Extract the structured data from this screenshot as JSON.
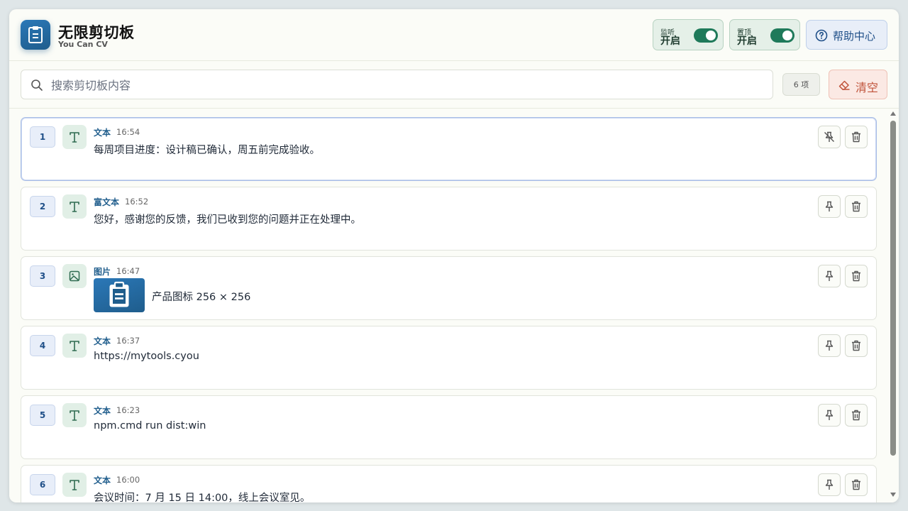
{
  "app": {
    "title": "无限剪切板",
    "subtitle": "You Can CV",
    "brand_color": "#1f5d8c"
  },
  "header": {
    "monitor": {
      "small_label": "监听",
      "state": "开启",
      "on": true
    },
    "pin_top": {
      "small_label": "置顶",
      "state": "开启",
      "on": true
    },
    "help_label": "帮助中心"
  },
  "search": {
    "placeholder": "搜索剪切板内容",
    "value": ""
  },
  "count_label": "6 项",
  "clear_label": "清空",
  "items": [
    {
      "index": "1",
      "type": "文本",
      "time": "16:54",
      "content": "每周项目进度：设计稿已确认，周五前完成验收。",
      "icon": "text-icon",
      "pinned": true
    },
    {
      "index": "2",
      "type": "富文本",
      "time": "16:52",
      "content": "您好，感谢您的反馈，我们已收到您的问题并正在处理中。",
      "icon": "text-icon",
      "pinned": false
    },
    {
      "index": "3",
      "type": "图片",
      "time": "16:47",
      "content": "产品图标 256 × 256",
      "icon": "image-icon",
      "pinned": false
    },
    {
      "index": "4",
      "type": "文本",
      "time": "16:37",
      "content": "https://mytools.cyou",
      "icon": "text-icon",
      "pinned": false
    },
    {
      "index": "5",
      "type": "文本",
      "time": "16:23",
      "content": "npm.cmd run dist:win",
      "icon": "text-icon",
      "pinned": false
    },
    {
      "index": "6",
      "type": "文本",
      "time": "16:00",
      "content": "会议时间：7 月 15 日 14:00，线上会议室见。",
      "icon": "text-icon",
      "pinned": false
    }
  ]
}
